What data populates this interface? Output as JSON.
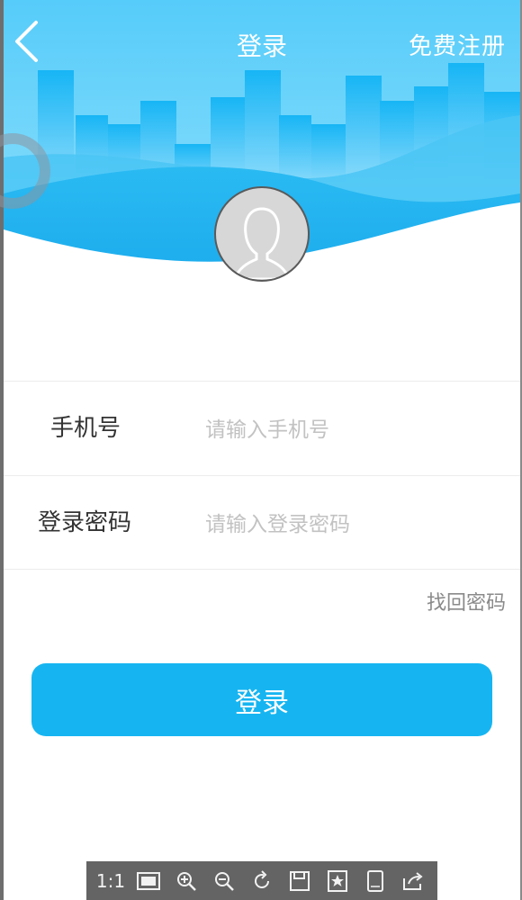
{
  "nav": {
    "back_icon": "chevron-left-icon",
    "title": "登录",
    "register_label": "免费注册"
  },
  "avatar": {
    "icon": "user-silhouette-icon"
  },
  "form": {
    "phone_label": "手机号",
    "phone_placeholder": "请输入手机号",
    "password_label": "登录密码",
    "password_placeholder": "请输入登录密码"
  },
  "forgot_password_label": "找回密码",
  "login_button_label": "登录",
  "viewer_toolbar": {
    "actual_size_label": "1:1",
    "buttons": [
      "fit-screen-icon",
      "zoom-in-icon",
      "zoom-out-icon",
      "rotate-icon",
      "save-icon",
      "bookmark-star-icon",
      "tablet-icon",
      "share-icon"
    ]
  },
  "colors": {
    "header_sky": "#56ccfa",
    "primary": "#16b5f1",
    "text": "#333333",
    "placeholder": "#c2c2c2",
    "toolbar_bg": "#646464"
  }
}
